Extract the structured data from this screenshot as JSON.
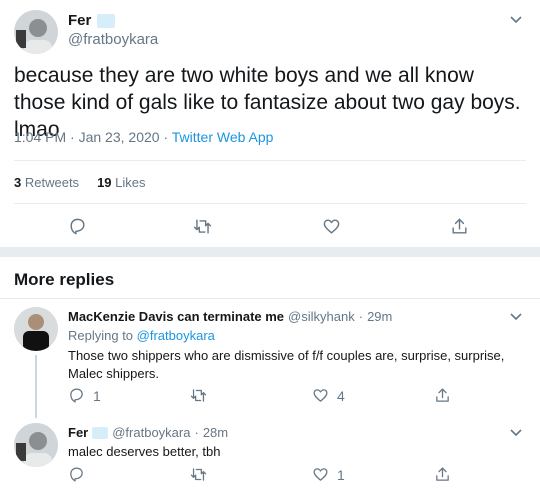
{
  "main_tweet": {
    "name": "Fer",
    "handle": "@fratboykara",
    "text": "because they are two white boys and we all know those kind of gals like to fantasize about two gay boys. lmao",
    "time": "1:04 PM",
    "sep": "·",
    "date": "Jan 23, 2020",
    "source": "Twitter Web App",
    "retweets_count": "3",
    "retweets_label": "Retweets",
    "likes_count": "19",
    "likes_label": "Likes"
  },
  "more_replies": {
    "title": "More replies"
  },
  "replies": [
    {
      "name": "MacKenzie Davis can terminate me",
      "handle": "@silkyhank",
      "sep": "·",
      "time": "29m",
      "replying_prefix": "Replying to",
      "replying_to": "@fratboykara",
      "text": "Those two shippers who are dismissive of f/f couples are, surprise, surprise, Malec shippers.",
      "reply_count": "1",
      "like_count": "4"
    },
    {
      "name": "Fer",
      "handle": "@fratboykara",
      "sep": "·",
      "time": "28m",
      "text": "malec deserves better, tbh",
      "like_count": "1"
    }
  ],
  "icons": {
    "reply": "reply-icon",
    "retweet": "retweet-icon",
    "like": "heart-icon",
    "share": "share-icon",
    "chevron": "chevron-down-icon",
    "verified_emoji": "snowflake-emoji"
  },
  "colors": {
    "link": "#1b95e0",
    "muted": "#657786",
    "divider": "#e6ecf0"
  }
}
